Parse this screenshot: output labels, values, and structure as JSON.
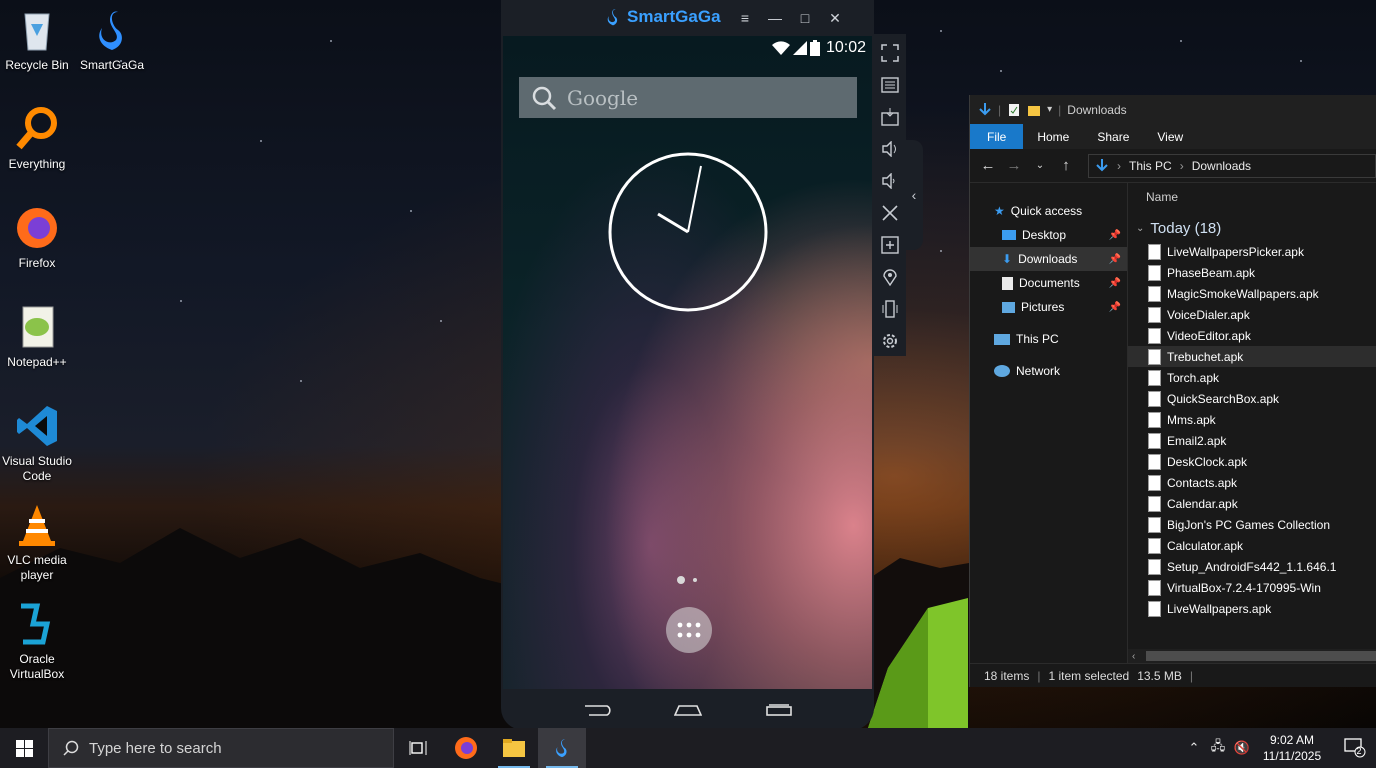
{
  "desktop": {
    "icons": [
      {
        "label": "Recycle Bin",
        "icon": "recycle-bin-icon"
      },
      {
        "label": "SmartGaGa",
        "icon": "smartgaga-icon"
      },
      {
        "label": "Everything",
        "icon": "everything-search-icon"
      },
      {
        "label": "Firefox",
        "icon": "firefox-icon"
      },
      {
        "label": "Notepad++",
        "icon": "notepadplusplus-icon"
      },
      {
        "label": "Visual Studio Code",
        "icon": "vscode-icon"
      },
      {
        "label": "VLC media player",
        "icon": "vlc-icon"
      },
      {
        "label": "Oracle VirtualBox",
        "icon": "virtualbox-icon"
      }
    ]
  },
  "emulator": {
    "brand": "SmartGaGa",
    "status_time": "10:02",
    "search_placeholder": "Google",
    "toolbar": [
      "fullscreen-icon",
      "keyboard-icon",
      "apk-install-icon",
      "volume-up-icon",
      "volume-down-icon",
      "screenshot-scissors-icon",
      "add-app-icon",
      "location-icon",
      "shake-icon",
      "settings-icon"
    ]
  },
  "explorer": {
    "title": "Downloads",
    "ribbon": {
      "file": "File",
      "home": "Home",
      "share": "Share",
      "view": "View"
    },
    "path": {
      "root": "This PC",
      "current": "Downloads"
    },
    "nav": {
      "quick_access": "Quick access",
      "desktop": "Desktop",
      "downloads": "Downloads",
      "documents": "Documents",
      "pictures": "Pictures",
      "this_pc": "This PC",
      "network": "Network"
    },
    "column_name": "Name",
    "group_label": "Today (18)",
    "files": [
      "LiveWallpapersPicker.apk",
      "PhaseBeam.apk",
      "MagicSmokeWallpapers.apk",
      "VoiceDialer.apk",
      "VideoEditor.apk",
      "Trebuchet.apk",
      "Torch.apk",
      "QuickSearchBox.apk",
      "Mms.apk",
      "Email2.apk",
      "DeskClock.apk",
      "Contacts.apk",
      "Calendar.apk",
      "BigJon's PC Games Collection",
      "Calculator.apk",
      "Setup_AndroidFs442_1.1.646.1",
      "VirtualBox-7.2.4-170995-Win",
      "LiveWallpapers.apk"
    ],
    "status": {
      "items": "18 items",
      "selected": "1 item selected",
      "size": "13.5 MB"
    }
  },
  "taskbar": {
    "search_placeholder": "Type here to search",
    "time": "9:02 AM",
    "date": "11/11/2025",
    "notification_count": "2"
  },
  "colors": {
    "accent": "#1979ca",
    "smartgaga_blue": "#3aa0ff"
  }
}
